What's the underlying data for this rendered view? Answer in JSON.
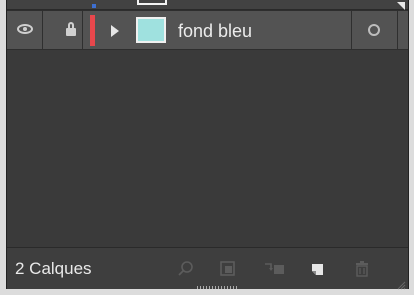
{
  "panel": {
    "layers": [
      {
        "name": "fond bleu",
        "visible": true,
        "locked": true,
        "expanded": false,
        "layer_color": "#e8474c",
        "thumbnail_color": "#9fe1df"
      }
    ],
    "footer": {
      "layer_count": "2 Calques",
      "buttons": [
        "search-icon",
        "clipping-mask-icon",
        "move-to-layer-icon",
        "new-layer-icon",
        "trash-icon"
      ]
    }
  },
  "colors": {
    "panel_bg": "#3a3a3a",
    "row_bg": "#535353",
    "text": "#ececec"
  }
}
